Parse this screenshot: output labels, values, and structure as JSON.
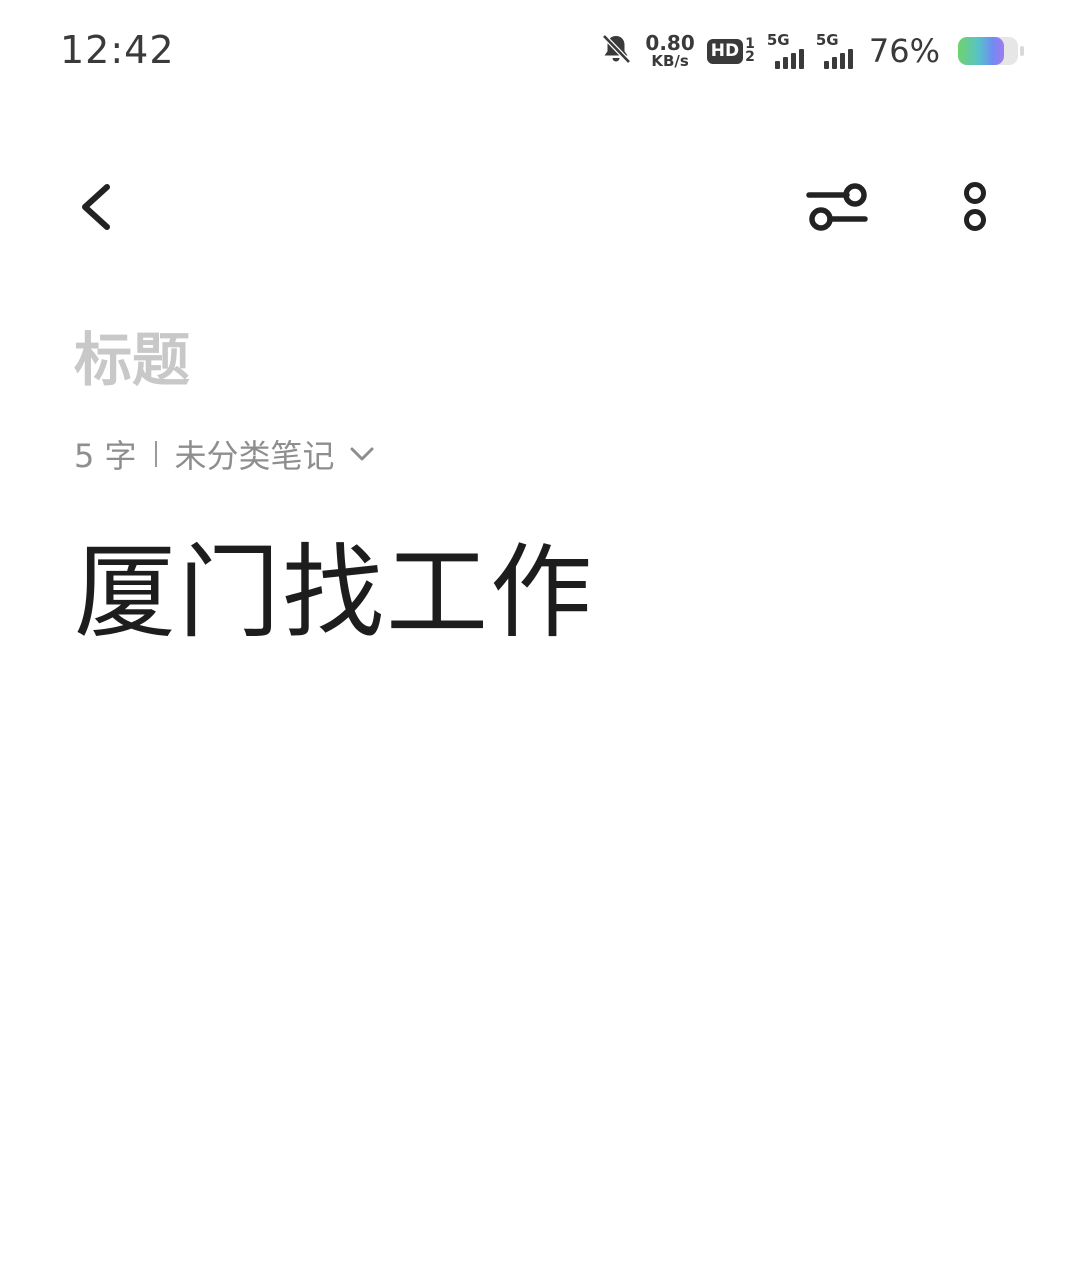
{
  "status_bar": {
    "time": "12:42",
    "net_speed_value": "0.80",
    "net_speed_unit": "KB/s",
    "hd_label": "HD",
    "hd_sim_top": "1",
    "hd_sim_bottom": "2",
    "sim1_type": "5G",
    "sim2_type": "5G",
    "battery_percent": "76%",
    "battery_level": 0.76,
    "icons": [
      "bell-muted-icon",
      "hd-voice-icon",
      "signal-5g-icon",
      "signal-5g-icon",
      "battery-icon"
    ]
  },
  "toolbar": {
    "icons": [
      "back-arrow-icon",
      "format-settings-icon",
      "more-vertical-icon"
    ]
  },
  "note": {
    "title_placeholder": "标题",
    "word_count": "5 字",
    "category": "未分类笔记",
    "body": "厦门找工作"
  },
  "colors": {
    "background": "#ffffff",
    "placeholder": "#c8c8c8",
    "meta_text": "#8e8e8e",
    "body_text": "#1d1d1d"
  }
}
